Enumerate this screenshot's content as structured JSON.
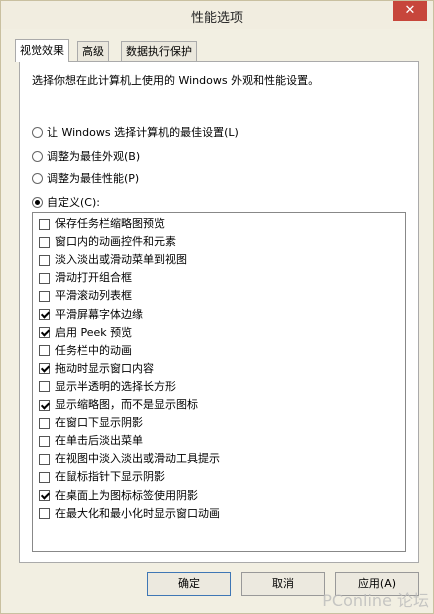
{
  "window": {
    "title": "性能选项",
    "close_label": "✕"
  },
  "tabs": [
    {
      "label": "视觉效果",
      "active": true
    },
    {
      "label": "高级",
      "active": false
    },
    {
      "label": "数据执行保护",
      "active": false
    }
  ],
  "description": "选择你想在此计算机上使用的 Windows 外观和性能设置。",
  "radios": [
    {
      "label": "让 Windows 选择计算机的最佳设置(L)",
      "checked": false
    },
    {
      "label": "调整为最佳外观(B)",
      "checked": false
    },
    {
      "label": "调整为最佳性能(P)",
      "checked": false
    },
    {
      "label": "自定义(C):",
      "checked": true
    }
  ],
  "effects": [
    {
      "label": "保存任务栏缩略图预览",
      "checked": false
    },
    {
      "label": "窗口内的动画控件和元素",
      "checked": false
    },
    {
      "label": "淡入淡出或滑动菜单到视图",
      "checked": false
    },
    {
      "label": "滑动打开组合框",
      "checked": false
    },
    {
      "label": "平滑滚动列表框",
      "checked": false
    },
    {
      "label": "平滑屏幕字体边缘",
      "checked": true
    },
    {
      "label": "启用 Peek 预览",
      "checked": true
    },
    {
      "label": "任务栏中的动画",
      "checked": false
    },
    {
      "label": "拖动时显示窗口内容",
      "checked": true
    },
    {
      "label": "显示半透明的选择长方形",
      "checked": false
    },
    {
      "label": "显示缩略图，而不是显示图标",
      "checked": true
    },
    {
      "label": "在窗口下显示阴影",
      "checked": false
    },
    {
      "label": "在单击后淡出菜单",
      "checked": false
    },
    {
      "label": "在视图中淡入淡出或滑动工具提示",
      "checked": false
    },
    {
      "label": "在鼠标指针下显示阴影",
      "checked": false
    },
    {
      "label": "在桌面上为图标标签使用阴影",
      "checked": true
    },
    {
      "label": "在最大化和最小化时显示窗口动画",
      "checked": false
    }
  ],
  "buttons": {
    "ok": "确定",
    "cancel": "取消",
    "apply": "应用(A)"
  },
  "watermark": "PConline 论坛"
}
